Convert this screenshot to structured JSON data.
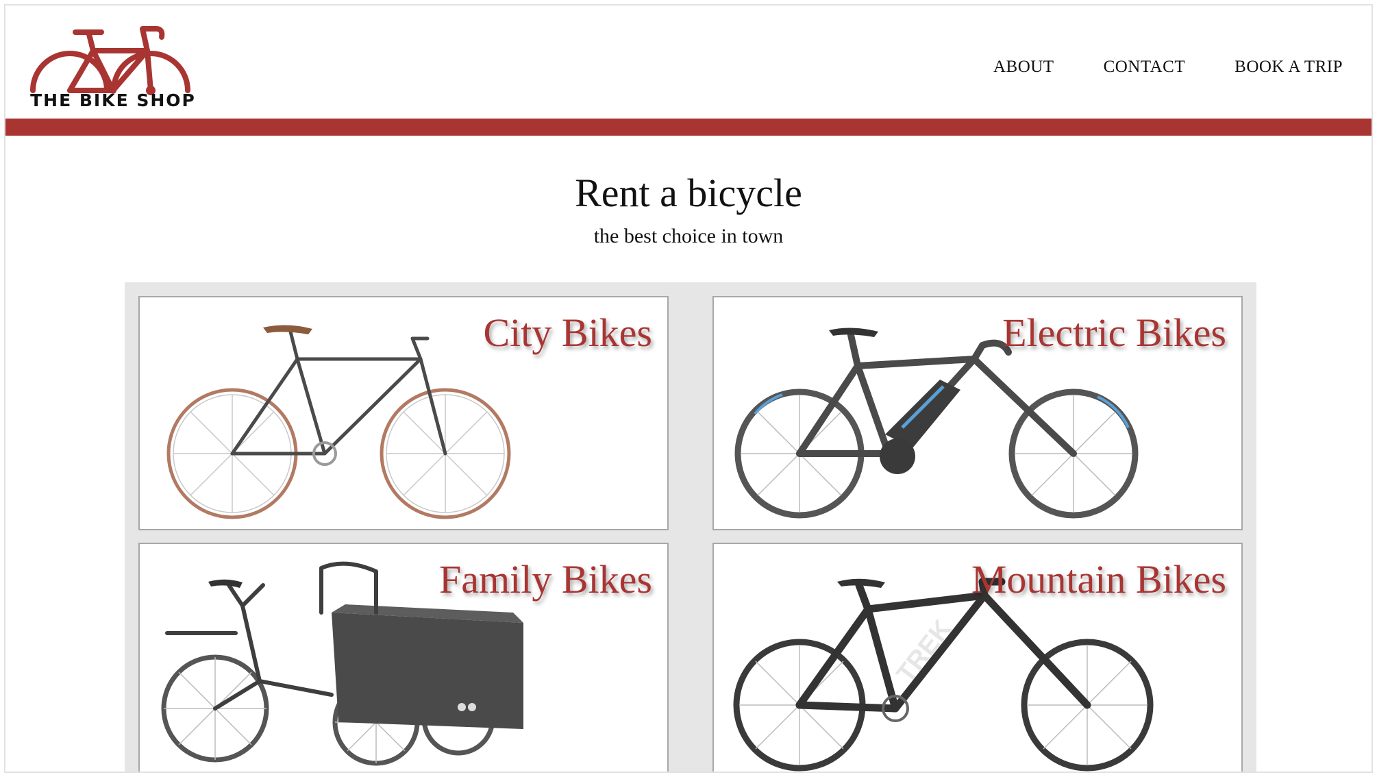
{
  "brand": {
    "logo_text": "THE BIKE SHOP",
    "accent": "#a93532"
  },
  "nav": {
    "items": [
      "ABOUT",
      "CONTACT",
      "BOOK A TRIP"
    ]
  },
  "hero": {
    "title": "Rent a bicycle",
    "subtitle": "the best choice in town"
  },
  "cards": [
    {
      "title": "City Bikes",
      "icon": "city-bike-image"
    },
    {
      "title": "Electric Bikes",
      "icon": "electric-bike-image"
    },
    {
      "title": "Family Bikes",
      "icon": "cargo-bike-image"
    },
    {
      "title": "Mountain Bikes",
      "icon": "mountain-bike-image"
    }
  ]
}
